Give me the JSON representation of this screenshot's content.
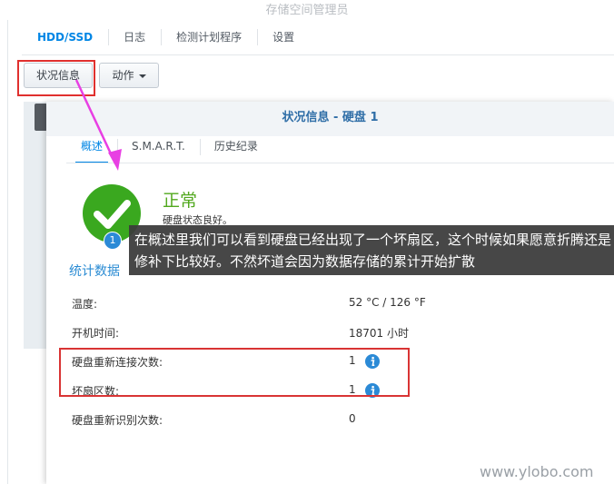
{
  "window": {
    "title": "存储空间管理员"
  },
  "main_tabs": [
    {
      "label": "HDD/SSD"
    },
    {
      "label": "日志"
    },
    {
      "label": "检测计划程序"
    },
    {
      "label": "设置"
    }
  ],
  "toolbar": {
    "status_label": "状况信息",
    "action_label": "动作"
  },
  "dialog": {
    "title": "状况信息 - 硬盘 1",
    "tabs": [
      {
        "label": "概述"
      },
      {
        "label": "S.M.A.R.T."
      },
      {
        "label": "历史纪录"
      }
    ],
    "status": {
      "text": "正常",
      "desc": "硬盘状态良好。",
      "color": "#51a81d",
      "badge": "1"
    },
    "stats_title": "统计数据",
    "stats": [
      {
        "label": "温度:",
        "value": "52 °C / 126 °F"
      },
      {
        "label": "开机时间:",
        "value": "18701 小时"
      },
      {
        "label": "硬盘重新连接次数:",
        "value": "1"
      },
      {
        "label": "坏扇区数:",
        "value": "1"
      },
      {
        "label": "硬盘重新识别次数:",
        "value": "0"
      }
    ]
  },
  "annotation": {
    "text": "在概述里我们可以看到硬盘已经出现了一个坏扇区，这个时候如果愿意折腾还是修补下比较好。不然坏道会因为数据存储的累计开始扩散",
    "arrow_color": "#e83fe3",
    "box_color": "#e0302e"
  },
  "watermark": "www.ylobo.com",
  "colors": {
    "accent": "#0086e5",
    "title_blue": "#2f6ea7",
    "info_icon": "#2b8ad6"
  }
}
